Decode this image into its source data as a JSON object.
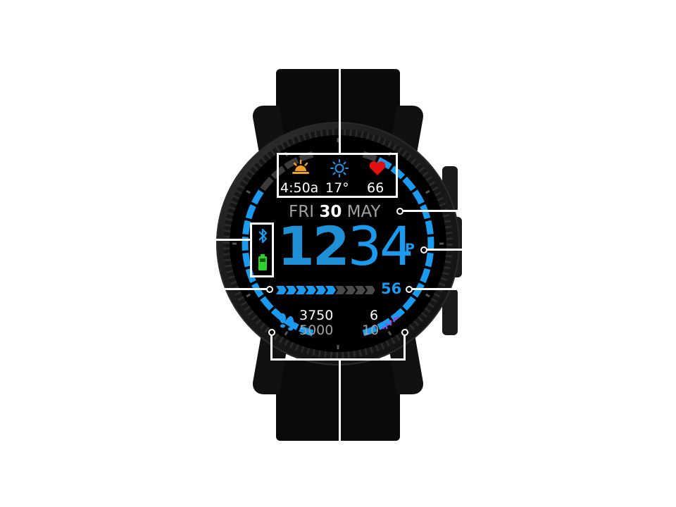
{
  "top_complications": {
    "sunrise": {
      "icon": "sunrise-icon",
      "value": "4:50a",
      "color": "#f0a020"
    },
    "weather": {
      "icon": "sun-icon",
      "value": "17°",
      "color": "#1a9bef"
    },
    "heart_rate": {
      "icon": "heart-icon",
      "value": "66",
      "color": "#e01010"
    }
  },
  "date": {
    "weekday": "FRI",
    "day": "30",
    "month": "MAY"
  },
  "time": {
    "hour": "12",
    "minute": "34",
    "ampm": "P"
  },
  "status": {
    "bluetooth_icon": "bluetooth-icon",
    "battery_icon": "battery-icon",
    "battery_color": "#2bd22b"
  },
  "progress": {
    "value": "56",
    "fraction": 0.56,
    "accent": "#1a9bef"
  },
  "steps": {
    "icon": "footsteps-icon",
    "current": "3750",
    "goal": "5000"
  },
  "floors": {
    "icon": "stairs-icon",
    "current": "6",
    "goal": "10",
    "color": "#c02fd0"
  },
  "colors": {
    "accent": "#1a9bef",
    "ring_track": "#3a3a3a"
  }
}
